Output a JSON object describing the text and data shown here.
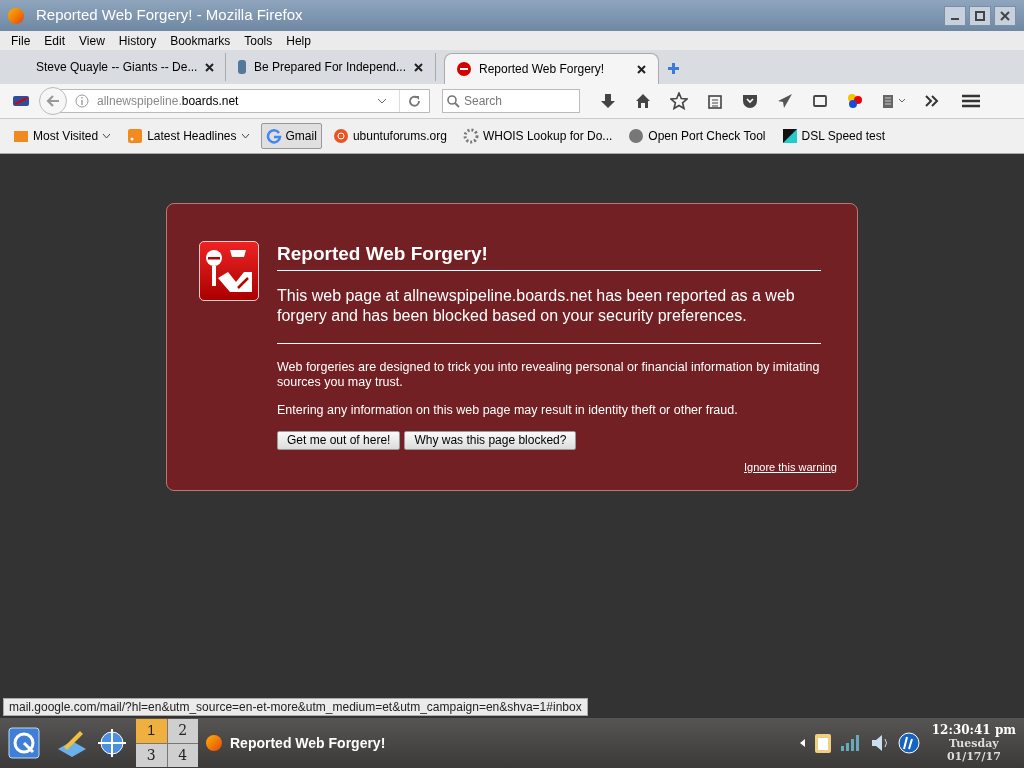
{
  "window": {
    "title": "Reported Web Forgery! - Mozilla Firefox"
  },
  "menu": [
    "File",
    "Edit",
    "View",
    "History",
    "Bookmarks",
    "Tools",
    "Help"
  ],
  "tabs": [
    {
      "label": "Steve Quayle -- Giants -- De...",
      "selected": false
    },
    {
      "label": "Be Prepared For Independ...",
      "selected": false
    },
    {
      "label": "Reported Web Forgery!",
      "selected": true
    }
  ],
  "url": {
    "prefix": "allnewspipeline.",
    "domain": "boards.net"
  },
  "search": {
    "placeholder": "Search"
  },
  "bookmarks": [
    {
      "label": "Most Visited",
      "dropdown": true,
      "selected": false
    },
    {
      "label": "Latest Headlines",
      "dropdown": true,
      "selected": false
    },
    {
      "label": "Gmail",
      "dropdown": false,
      "selected": true
    },
    {
      "label": "ubuntuforums.org",
      "dropdown": false,
      "selected": false
    },
    {
      "label": "WHOIS Lookup for Do...",
      "dropdown": false,
      "selected": false
    },
    {
      "label": "Open Port Check Tool",
      "dropdown": false,
      "selected": false
    },
    {
      "label": "DSL Speed test",
      "dropdown": false,
      "selected": false
    }
  ],
  "error": {
    "title": "Reported Web Forgery!",
    "intro": "This web page at allnewspipeline.boards.net has been reported as a web forgery and has been blocked based on your security preferences.",
    "paragraphs": [
      "Web forgeries are designed to trick you into revealing personal or financial information by imitating sources you may trust.",
      "Entering any information on this web page may result in identity theft or other fraud."
    ],
    "buttons": [
      "Get me out of here!",
      "Why was this page blocked?"
    ],
    "ignore_link": "Ignore this warning"
  },
  "status_bar": "mail.google.com/mail/?hl=en&utm_source=en-et-more&utm_medium=et&utm_campaign=en&shva=1#inbox",
  "taskbar": {
    "pager": [
      {
        "label": "1",
        "selected": true
      },
      {
        "label": "2",
        "selected": false
      },
      {
        "label": "3",
        "selected": false
      },
      {
        "label": "4",
        "selected": false
      }
    ],
    "task": "Reported Web Forgery!",
    "time": "12:30:41 pm",
    "day": "Tuesday",
    "date": "01/17/17"
  }
}
